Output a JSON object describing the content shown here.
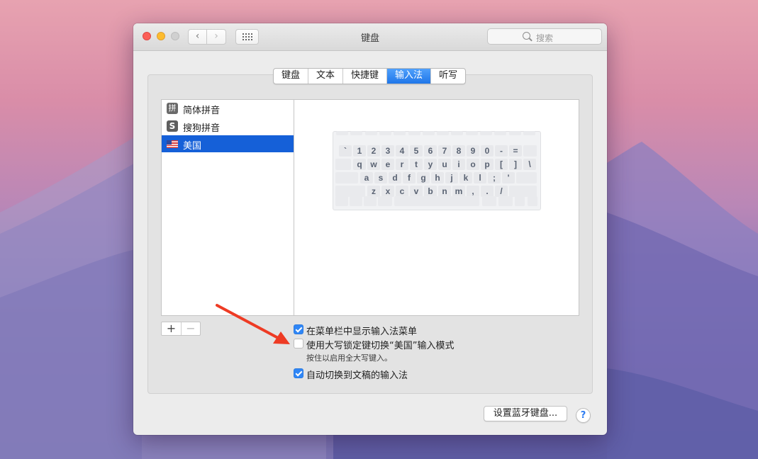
{
  "window": {
    "title": "键盘"
  },
  "search": {
    "placeholder": "搜索"
  },
  "tabs": [
    {
      "label": "键盘",
      "active": false
    },
    {
      "label": "文本",
      "active": false
    },
    {
      "label": "快捷键",
      "active": false
    },
    {
      "label": "输入法",
      "active": true
    },
    {
      "label": "听写",
      "active": false
    }
  ],
  "input_sources": [
    {
      "label": "简体拼音",
      "icon": "pinyin-icon",
      "icon_glyph": "拼",
      "selected": false
    },
    {
      "label": "搜狗拼音",
      "icon": "sogou-icon",
      "icon_glyph": "S",
      "selected": false
    },
    {
      "label": "美国",
      "icon": "us-flag-icon",
      "selected": true
    }
  ],
  "keyboard": {
    "rows": [
      [
        "`",
        "1",
        "2",
        "3",
        "4",
        "5",
        "6",
        "7",
        "8",
        "9",
        "0",
        "-",
        "="
      ],
      [
        "q",
        "w",
        "e",
        "r",
        "t",
        "y",
        "u",
        "i",
        "o",
        "p",
        "[",
        "]",
        "\\"
      ],
      [
        "a",
        "s",
        "d",
        "f",
        "g",
        "h",
        "j",
        "k",
        "l",
        ";",
        "'"
      ],
      [
        "z",
        "x",
        "c",
        "v",
        "b",
        "n",
        "m",
        ",",
        ".",
        "/"
      ]
    ]
  },
  "list_controls": {
    "add": "+",
    "remove": "−"
  },
  "options": {
    "show_menu": {
      "label": "在菜单栏中显示输入法菜单",
      "checked": true
    },
    "caps_lock": {
      "label": "使用大写锁定键切换“美国”输入模式",
      "checked": false,
      "hint": "按住以启用全大写键入。"
    },
    "auto_switch": {
      "label": "自动切换到文稿的输入法",
      "checked": true
    }
  },
  "footer": {
    "bluetooth_button": "设置蓝牙键盘...",
    "help": "?"
  },
  "colors": {
    "accent": "#1f76e9",
    "selection": "#1560d8",
    "annotation_arrow": "#ee3b24"
  }
}
